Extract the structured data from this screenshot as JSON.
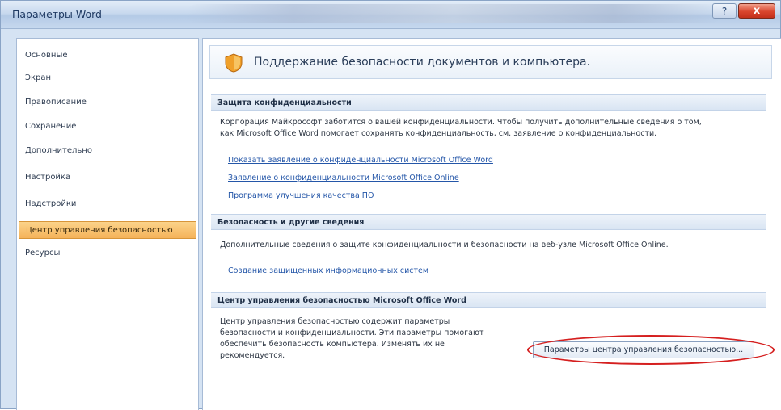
{
  "window": {
    "title": "Параметры Word",
    "help_icon": "?",
    "close_icon": "x"
  },
  "sidebar": {
    "items": [
      {
        "label": "Основные"
      },
      {
        "label": "Экран"
      },
      {
        "label": "Правописание"
      },
      {
        "label": "Сохранение"
      },
      {
        "label": "Дополнительно"
      },
      {
        "label": "Настройка"
      },
      {
        "label": "Надстройки"
      },
      {
        "label": "Центр управления безопасностью",
        "selected": true
      },
      {
        "label": "Ресурсы"
      }
    ]
  },
  "main": {
    "header_title": "Поддержание безопасности документов и компьютера.",
    "privacy": {
      "heading": "Защита конфиденциальности",
      "text_line1": "Корпорация Майкрософт заботится о вашей конфиденциальности. Чтобы получить дополнительные сведения о том,",
      "text_line2": "как Microsoft Office Word помогает сохранять конфиденциальность, см. заявление о конфиденциальности.",
      "links": [
        "Показать заявление о конфиденциальности Microsoft Office Word",
        "Заявление о конфиденциальности Microsoft Office Online",
        "Программа улучшения качества ПО"
      ]
    },
    "security": {
      "heading": "Безопасность и другие сведения",
      "text": "Дополнительные сведения о защите конфиденциальности и безопасности на веб-узле Microsoft Office Online.",
      "link": "Создание защищенных информационных систем"
    },
    "trust_center": {
      "heading": "Центр управления безопасностью Microsoft Office Word",
      "text_line1": "Центр управления безопасностью содержит параметры",
      "text_line2": "безопасности и конфиденциальности. Эти параметры помогают",
      "text_line3": "обеспечить безопасность компьютера. Изменять их не",
      "text_line4": "рекомендуется.",
      "button_label": "Параметры центра управления безопасностью..."
    }
  },
  "colors": {
    "selected_nav": "#f5b35a",
    "annotation": "#d51f1f",
    "link": "#2456a8"
  },
  "icons": {
    "header": "shield-icon"
  }
}
